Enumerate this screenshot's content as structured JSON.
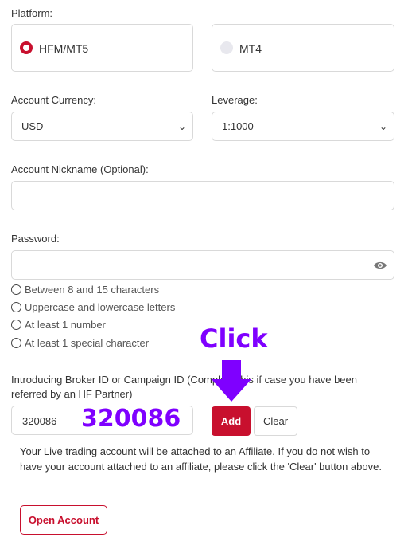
{
  "platform": {
    "label": "Platform:",
    "options": [
      {
        "label": "HFM/MT5",
        "selected": true
      },
      {
        "label": "MT4",
        "selected": false
      }
    ]
  },
  "currency": {
    "label": "Account Currency:",
    "value": "USD"
  },
  "leverage": {
    "label": "Leverage:",
    "value": "1:1000"
  },
  "nickname": {
    "label": "Account Nickname (Optional):",
    "value": ""
  },
  "password": {
    "label": "Password:",
    "value": "",
    "rules": [
      "Between 8 and 15 characters",
      "Uppercase and lowercase letters",
      "At least 1 number",
      "At least 1 special character"
    ]
  },
  "ib": {
    "label": "Introducing Broker ID or Campaign ID (Complete this if case you have been referred by an HF Partner)",
    "value": "320086",
    "add_label": "Add",
    "clear_label": "Clear",
    "note": "Your Live trading account will be attached to an Affiliate. If you do not wish to have your account attached to an affiliate, please click the 'Clear' button above."
  },
  "open_account_label": "Open Account",
  "annotation": {
    "click_text": "Click",
    "code_text": "320086",
    "color": "#7f00ff"
  },
  "colors": {
    "accent": "#c8102e"
  }
}
